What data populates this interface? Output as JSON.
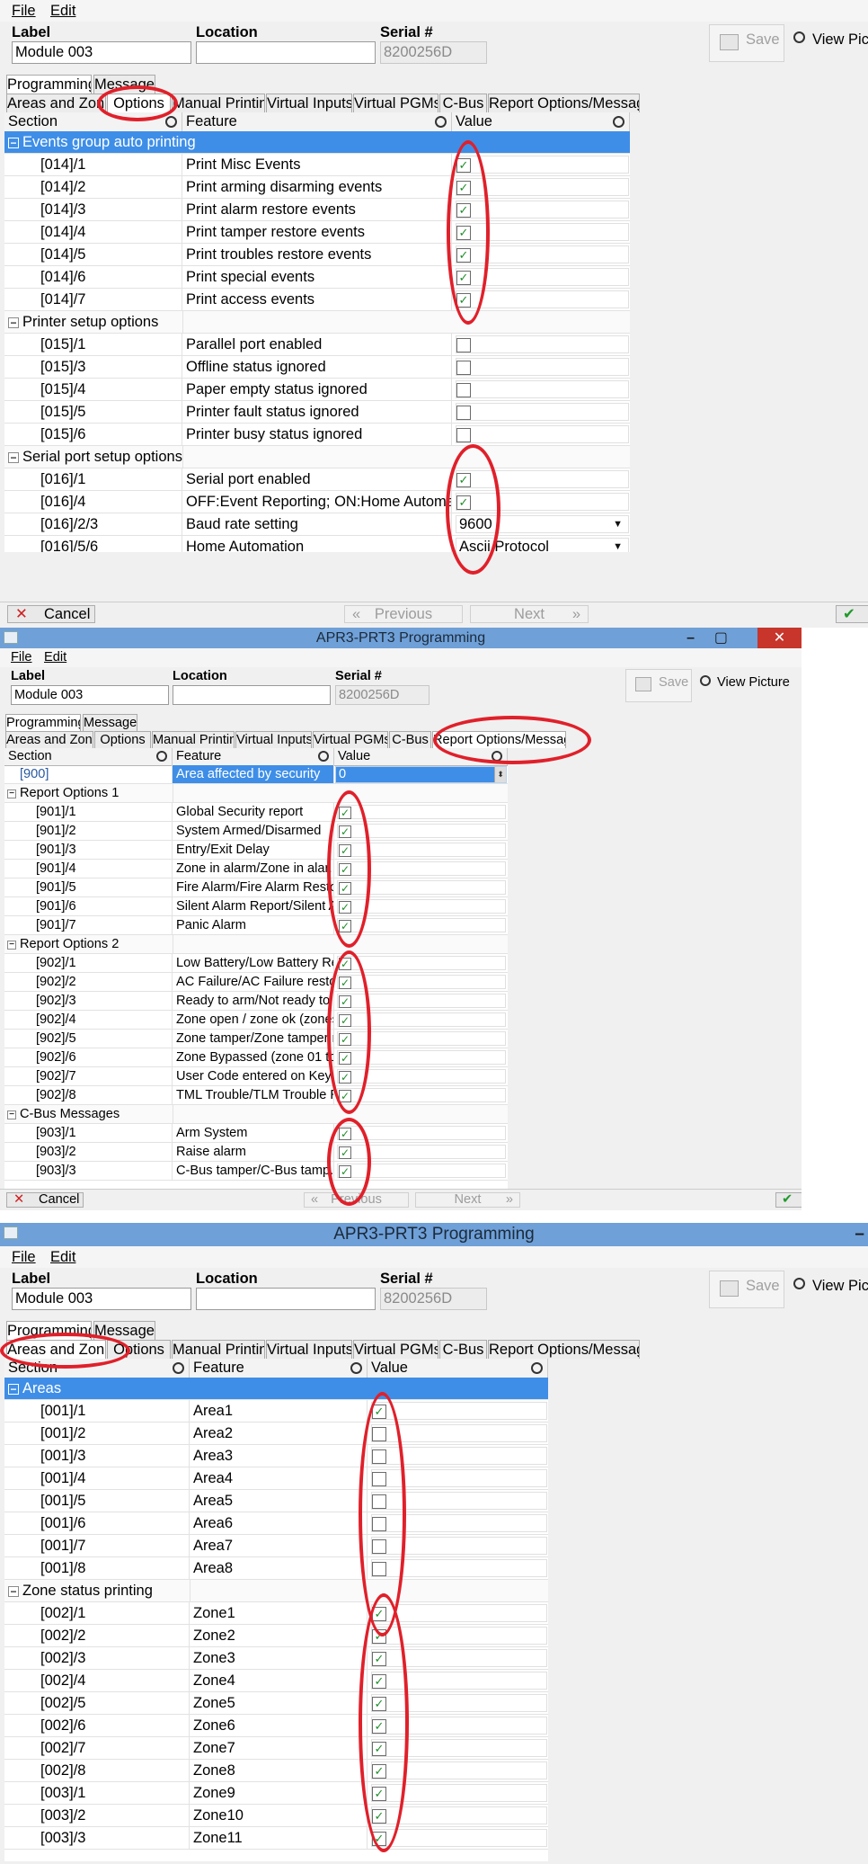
{
  "menu": {
    "file": "File",
    "edit": "Edit"
  },
  "app_title": "APR3-PRT3 Programming",
  "form": {
    "label_caption": "Label",
    "location_caption": "Location",
    "serial_caption": "Serial #",
    "label_value": "Module 003",
    "location_value": "",
    "serial_value": "8200256D"
  },
  "toolbar": {
    "save_label": "Save",
    "view_picture_label": "View Picture",
    "view_picture_label_clipped": "View Pictur"
  },
  "top_tabs": [
    "Programming",
    "Messages"
  ],
  "sub_tabs": [
    "Areas and Zones",
    "Options",
    "Manual Printing",
    "Virtual Inputs",
    "Virtual PGMs",
    "C-Bus",
    "Report Options/Messages"
  ],
  "columns": {
    "section": "Section",
    "feature": "Feature",
    "value": "Value"
  },
  "footer": {
    "cancel": "Cancel",
    "previous": "Previous",
    "next": "Next",
    "ok": "OK"
  },
  "colors": {
    "selection_blue": "#3e8ee7",
    "title_bar": "#6fa0d8",
    "annotation_red": "#e0202a",
    "check_green": "#1f8f2a"
  },
  "icons": [
    "save-icon",
    "camera-icon",
    "magnifier-icon",
    "collapse-icon",
    "cancel-x-icon",
    "previous-chevrons-icon",
    "next-chevrons-icon",
    "ok-check-icon",
    "app-icon",
    "minimize-icon",
    "maximize-icon",
    "close-icon",
    "dropdown-arrow-icon",
    "spin-arrows-icon"
  ],
  "panel1": {
    "groups": [
      {
        "title": "Events group auto printing",
        "selected": true,
        "rows": [
          {
            "section": "[014]/1",
            "feature": "Print Misc Events",
            "checked": true
          },
          {
            "section": "[014]/2",
            "feature": "Print arming disarming events",
            "checked": true
          },
          {
            "section": "[014]/3",
            "feature": "Print alarm restore events",
            "checked": true
          },
          {
            "section": "[014]/4",
            "feature": "Print tamper restore events",
            "checked": true
          },
          {
            "section": "[014]/5",
            "feature": "Print troubles restore events",
            "checked": true
          },
          {
            "section": "[014]/6",
            "feature": "Print special events",
            "checked": true
          },
          {
            "section": "[014]/7",
            "feature": "Print access events",
            "checked": true
          }
        ]
      },
      {
        "title": "Printer setup options",
        "rows": [
          {
            "section": "[015]/1",
            "feature": "Parallel port enabled",
            "checked": false
          },
          {
            "section": "[015]/3",
            "feature": "Offline status ignored",
            "checked": false
          },
          {
            "section": "[015]/4",
            "feature": "Paper empty status ignored",
            "checked": false
          },
          {
            "section": "[015]/5",
            "feature": "Printer fault status ignored",
            "checked": false
          },
          {
            "section": "[015]/6",
            "feature": "Printer busy status ignored",
            "checked": false
          }
        ]
      },
      {
        "title": "Serial port setup options",
        "rows": [
          {
            "section": "[016]/1",
            "feature": "Serial port enabled",
            "checked": true
          },
          {
            "section": "[016]/4",
            "feature": "OFF:Event Reporting; ON:Home Automation",
            "checked": true
          },
          {
            "section": "[016]/2/3",
            "feature": "Baud rate setting",
            "select": "9600"
          },
          {
            "section": "[016]/5/6",
            "feature": "Home Automation",
            "select": "Ascii Protocol"
          }
        ]
      }
    ]
  },
  "panel2": {
    "top_row": {
      "section": "[900]",
      "feature": "Area affected by security",
      "value": "0"
    },
    "groups": [
      {
        "title": "Report Options 1",
        "rows": [
          {
            "section": "[901]/1",
            "feature": "Global Security report",
            "checked": true
          },
          {
            "section": "[901]/2",
            "feature": "System Armed/Disarmed",
            "checked": true
          },
          {
            "section": "[901]/3",
            "feature": "Entry/Exit Delay",
            "checked": true
          },
          {
            "section": "[901]/4",
            "feature": "Zone in alarm/Zone in alar...",
            "checked": true
          },
          {
            "section": "[901]/5",
            "feature": "Fire Alarm/Fire Alarm Resto...",
            "checked": true
          },
          {
            "section": "[901]/6",
            "feature": "Silent Alarm Report/Silent A...",
            "checked": true
          },
          {
            "section": "[901]/7",
            "feature": "Panic Alarm",
            "checked": true
          }
        ]
      },
      {
        "title": "Report Options 2",
        "rows": [
          {
            "section": "[902]/1",
            "feature": "Low Battery/Low Battery Re...",
            "checked": true
          },
          {
            "section": "[902]/2",
            "feature": "AC Failure/AC Failure restore",
            "checked": true
          },
          {
            "section": "[902]/3",
            "feature": "Ready to arm/Not ready to a...",
            "checked": true
          },
          {
            "section": "[902]/4",
            "feature": "Zone open / zone ok (zones...",
            "checked": true
          },
          {
            "section": "[902]/5",
            "feature": "Zone tamper/Zone tamper r...",
            "checked": true
          },
          {
            "section": "[902]/6",
            "feature": "Zone Bypassed (zone 01 to ...",
            "checked": true
          },
          {
            "section": "[902]/7",
            "feature": "User Code entered on Keyp...",
            "checked": true
          },
          {
            "section": "[902]/8",
            "feature": "TML Trouble/TLM Trouble R...",
            "checked": true
          }
        ]
      },
      {
        "title": "C-Bus Messages",
        "rows": [
          {
            "section": "[903]/1",
            "feature": "Arm System",
            "checked": true
          },
          {
            "section": "[903]/2",
            "feature": "Raise alarm",
            "checked": true
          },
          {
            "section": "[903]/3",
            "feature": "C-Bus tamper/C-Bus tamp...",
            "checked": true
          }
        ]
      }
    ]
  },
  "panel3": {
    "groups": [
      {
        "title": "Areas",
        "selected": true,
        "rows": [
          {
            "section": "[001]/1",
            "feature": "Area1",
            "checked": true
          },
          {
            "section": "[001]/2",
            "feature": "Area2",
            "checked": false
          },
          {
            "section": "[001]/3",
            "feature": "Area3",
            "checked": false
          },
          {
            "section": "[001]/4",
            "feature": "Area4",
            "checked": false
          },
          {
            "section": "[001]/5",
            "feature": "Area5",
            "checked": false
          },
          {
            "section": "[001]/6",
            "feature": "Area6",
            "checked": false
          },
          {
            "section": "[001]/7",
            "feature": "Area7",
            "checked": false
          },
          {
            "section": "[001]/8",
            "feature": "Area8",
            "checked": false
          }
        ]
      },
      {
        "title": "Zone status printing",
        "rows": [
          {
            "section": "[002]/1",
            "feature": "Zone1",
            "checked": true
          },
          {
            "section": "[002]/2",
            "feature": "Zone2",
            "checked": true
          },
          {
            "section": "[002]/3",
            "feature": "Zone3",
            "checked": true
          },
          {
            "section": "[002]/4",
            "feature": "Zone4",
            "checked": true
          },
          {
            "section": "[002]/5",
            "feature": "Zone5",
            "checked": true
          },
          {
            "section": "[002]/6",
            "feature": "Zone6",
            "checked": true
          },
          {
            "section": "[002]/7",
            "feature": "Zone7",
            "checked": true
          },
          {
            "section": "[002]/8",
            "feature": "Zone8",
            "checked": true
          },
          {
            "section": "[003]/1",
            "feature": "Zone9",
            "checked": true
          },
          {
            "section": "[003]/2",
            "feature": "Zone10",
            "checked": true
          },
          {
            "section": "[003]/3",
            "feature": "Zone11",
            "checked": true
          }
        ]
      }
    ]
  }
}
